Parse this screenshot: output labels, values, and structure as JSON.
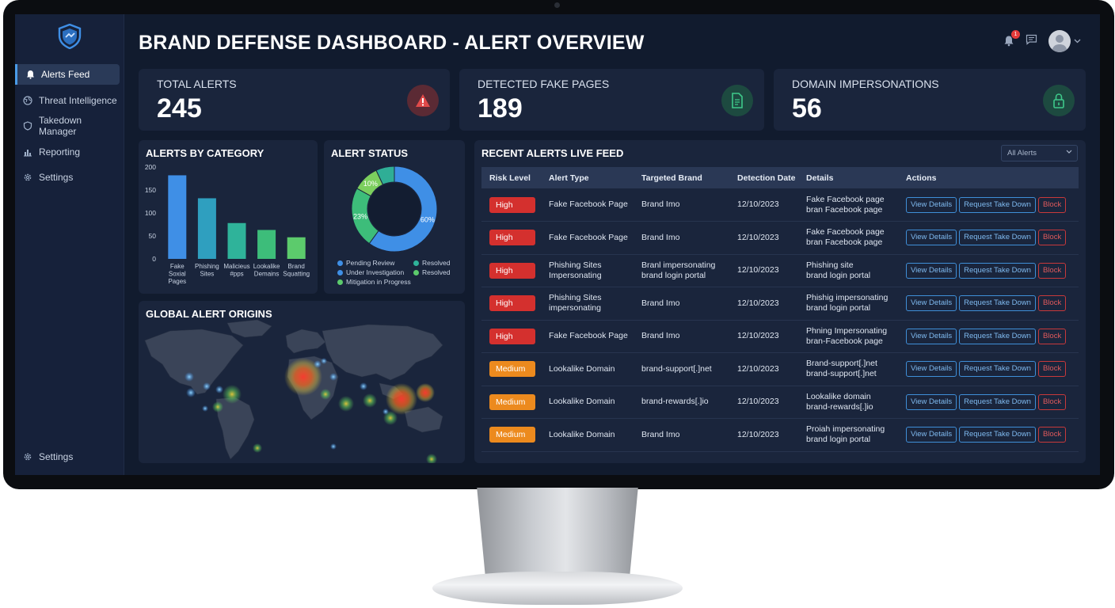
{
  "dashboard": {
    "title": "BRAND DEFENSE DASHBOARD - ALERT OVERVIEW",
    "notification_count": "1"
  },
  "sidebar": {
    "items": [
      {
        "label": "Alerts Feed",
        "icon": "bell-icon",
        "active": true
      },
      {
        "label": "Threat Intelligence",
        "icon": "globe-icon",
        "active": false
      },
      {
        "label": "Takedown Manager",
        "icon": "shield-icon",
        "active": false
      },
      {
        "label": "Reporting",
        "icon": "bar-chart-icon",
        "active": false
      },
      {
        "label": "Settings",
        "icon": "gear-icon",
        "active": false
      }
    ],
    "footer_settings": "Settings"
  },
  "stats": [
    {
      "label": "TOTAL ALERTS",
      "value": "245",
      "icon": "warning-icon",
      "color": "#e04a4a"
    },
    {
      "label": "DETECTED FAKE PAGES",
      "value": "189",
      "icon": "document-icon",
      "color": "#3ec98a"
    },
    {
      "label": "DOMAIN IMPERSONATIONS",
      "value": "56",
      "icon": "lock-icon",
      "color": "#3ec98a"
    }
  ],
  "panels": {
    "category_title": "ALERTS BY CATEGORY",
    "status_title": "ALERT STATUS",
    "map_title": "GLOBAL ALERT ORIGINS",
    "feed_title": "RECENT ALERTS LIVE FEED",
    "feed_filter": "All Alerts"
  },
  "chart_data": [
    {
      "type": "bar",
      "title": "ALERTS BY CATEGORY",
      "categories": [
        "Fake Soxial Pages",
        "Phishing Sites",
        "Malicieus #pps",
        "Lookalike Demains",
        "Brand Squatting"
      ],
      "category_lines": [
        [
          "Fake",
          "Soxial",
          "Pages"
        ],
        [
          "Phishing",
          "Sites"
        ],
        [
          "Malicieus",
          "#pps"
        ],
        [
          "Lookalike",
          "Demains"
        ],
        [
          "Brand",
          "Squatting"
        ]
      ],
      "values": [
        182,
        132,
        78,
        63,
        47
      ],
      "colors": [
        "#3f8fe6",
        "#2f9fbf",
        "#2fb39a",
        "#3dbd7a",
        "#5ccb6c"
      ],
      "ylim": [
        0,
        200
      ],
      "yticks": [
        0,
        50,
        100,
        150,
        200
      ]
    },
    {
      "type": "pie",
      "title": "ALERT STATUS",
      "slices": [
        {
          "name": "Pending Review",
          "value": 60,
          "label": "60%",
          "color": "#3f8fe6"
        },
        {
          "name": "Mitigation in Progress",
          "value": 23,
          "label": "23%",
          "color": "#3dbd7a"
        },
        {
          "name": "Resolved",
          "value": 10,
          "label": "10%",
          "color": "#7ccf5e"
        },
        {
          "name": "Under Investigation",
          "value": 7,
          "label": "",
          "color": "#2fae96"
        }
      ],
      "legend": [
        {
          "name": "Pending Review",
          "color": "#3f8fe6"
        },
        {
          "name": "Resolved",
          "color": "#2fb39a"
        },
        {
          "name": "Under Investigation",
          "color": "#3f8fe6"
        },
        {
          "name": "Resolved",
          "color": "#5ccb6c"
        },
        {
          "name": "Mitigation in Progress",
          "color": "#5ccb6c"
        }
      ]
    }
  ],
  "feed": {
    "columns": [
      "Risk Level",
      "Alert Type",
      "Targeted Brand",
      "Detection Date",
      "Details",
      "Actions"
    ],
    "actions": {
      "view": "View Details",
      "takedown": "Request Take Down",
      "block": "Block"
    },
    "rows": [
      {
        "risk": "High",
        "type": "Fake Facebook Page",
        "brand": "Brand Imo",
        "date": "12/10/2023",
        "details": [
          "Fake Facebook page",
          "bran Facebook page"
        ]
      },
      {
        "risk": "High",
        "type": "Fake Facebook Page",
        "brand": "Brand Imo",
        "date": "12/10/2023",
        "details": [
          "Fake Facebook page",
          "bran Facebook page"
        ]
      },
      {
        "risk": "High",
        "type": "Phishing Sites Impersonating",
        "brand": "Branl impersonating brand login portal",
        "date": "12/10/2023",
        "details": [
          "Phishing site",
          "brand login portal"
        ]
      },
      {
        "risk": "High",
        "type": "Phishing Sites impersonating",
        "brand": "Brand Imo",
        "date": "12/10/2023",
        "details": [
          "Phishig impersonating",
          "brand login portal"
        ]
      },
      {
        "risk": "High",
        "type": "Fake Facebook Page",
        "brand": "Brand Imo",
        "date": "12/10/2023",
        "details": [
          "Phning Impersonating",
          "bran-Facebook page"
        ]
      },
      {
        "risk": "Medium",
        "type": "Lookalike Domain",
        "brand": "brand-support[.]net",
        "date": "12/10/2023",
        "details": [
          "Brand-support[.]net",
          "brand-support[.]net"
        ]
      },
      {
        "risk": "Medium",
        "type": "Lookalike Domain",
        "brand": "brand-rewards[.]io",
        "date": "12/10/2023",
        "details": [
          "Lookalike domain",
          "brand-rewards[.]io"
        ]
      },
      {
        "risk": "Medium",
        "type": "Lookalike Domain",
        "brand": "Brand Imo",
        "date": "12/10/2023",
        "details": [
          "Proiah impersonating",
          "brand login portal"
        ]
      }
    ]
  }
}
